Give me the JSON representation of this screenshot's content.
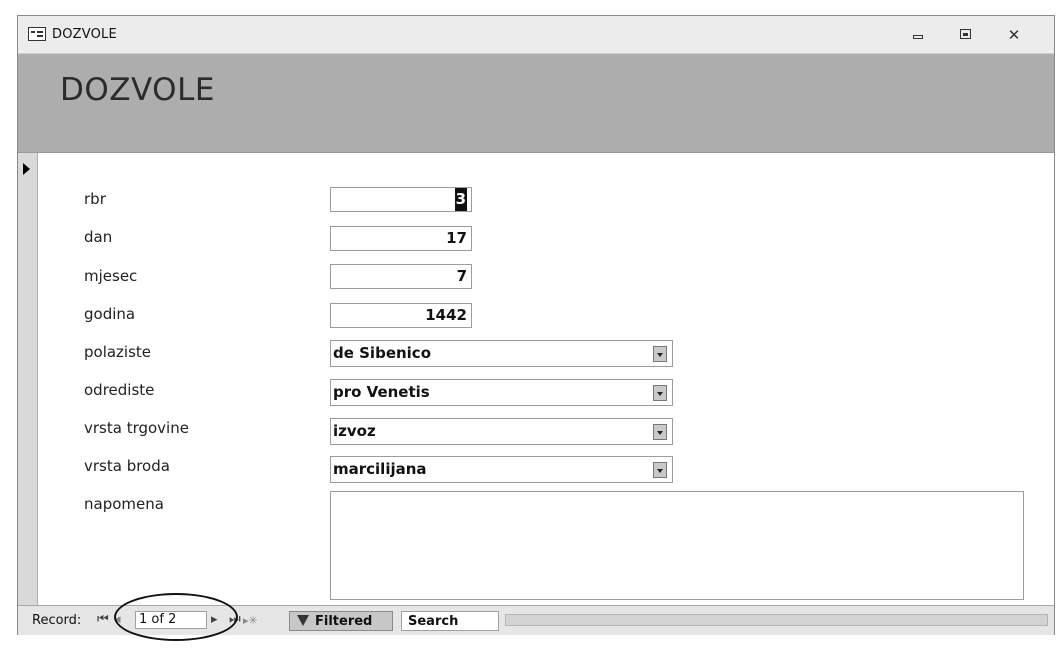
{
  "window": {
    "title": "DOZVOLE"
  },
  "header": {
    "title": "DOZVOLE"
  },
  "fields": {
    "rbr": {
      "label": "rbr",
      "value": "3"
    },
    "dan": {
      "label": "dan",
      "value": "17"
    },
    "mjesec": {
      "label": "mjesec",
      "value": "7"
    },
    "godina": {
      "label": "godina",
      "value": "1442"
    },
    "polaziste": {
      "label": "polaziste",
      "value": "de Sibenico"
    },
    "odrediste": {
      "label": "odrediste",
      "value": "pro Venetis"
    },
    "vrsta_trgovine": {
      "label": "vrsta trgovine",
      "value": "izvoz"
    },
    "vrsta_broda": {
      "label": "vrsta broda",
      "value": "marcilijana"
    },
    "napomena": {
      "label": "napomena",
      "value": ""
    }
  },
  "navigation": {
    "record_label": "Record:",
    "record_position": "1 of 2",
    "filter_label": "Filtered",
    "search_label": "Search"
  },
  "icons": {
    "window": "form-icon",
    "minimize": "minimize-icon",
    "maximize": "maximize-icon",
    "close": "close-icon",
    "filter": "filter-icon"
  }
}
